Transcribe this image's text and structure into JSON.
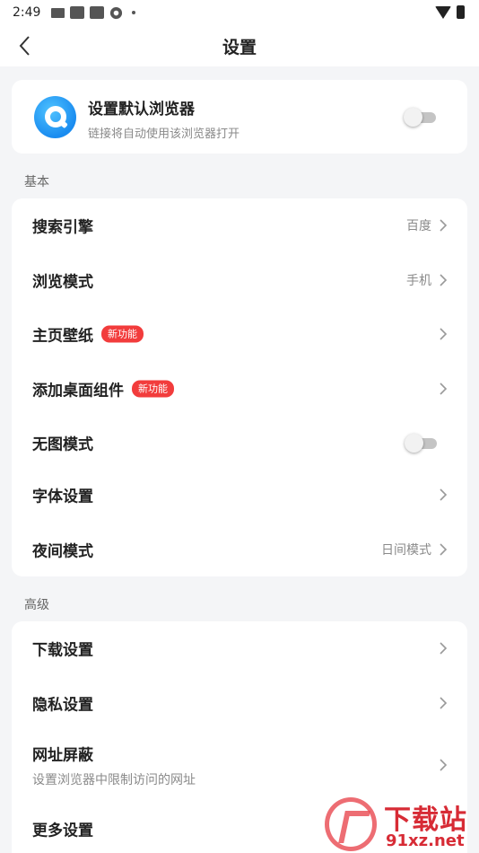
{
  "status_bar": {
    "time": "2:49"
  },
  "header": {
    "title": "设置"
  },
  "default_browser": {
    "title": "设置默认浏览器",
    "subtitle": "链接将自动使用该浏览器打开",
    "enabled": false
  },
  "sections": {
    "basic": {
      "label": "基本",
      "items": [
        {
          "label": "搜索引擎",
          "value": "百度"
        },
        {
          "label": "浏览模式",
          "value": "手机"
        },
        {
          "label": "主页壁纸",
          "badge": "新功能"
        },
        {
          "label": "添加桌面组件",
          "badge": "新功能"
        },
        {
          "label": "无图模式",
          "toggle": false
        },
        {
          "label": "字体设置"
        },
        {
          "label": "夜间模式",
          "value": "日间模式"
        }
      ]
    },
    "advanced": {
      "label": "高级",
      "items": [
        {
          "label": "下载设置"
        },
        {
          "label": "隐私设置"
        },
        {
          "label": "网址屏蔽",
          "subtitle": "设置浏览器中限制访问的网址"
        },
        {
          "label": "更多设置"
        }
      ]
    }
  },
  "watermark": {
    "title": "下载站",
    "url": "91xz.net"
  },
  "colors": {
    "accent": "#1a8cf0",
    "badge": "#f23c3c",
    "watermark": "#d72b35"
  }
}
